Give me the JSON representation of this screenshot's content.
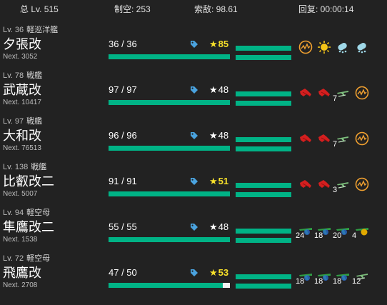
{
  "summary": {
    "total_lv": "总 Lv. 515",
    "air": "制空: 253",
    "los": "索敌: 98.61",
    "recover": "回复: 00:00:14"
  },
  "colors": {
    "background": "#222222",
    "bar_green": "#00b386",
    "sparkle_yellow": "#f7e02a",
    "tag_blue": "#4aa3df"
  },
  "ships": [
    {
      "level": "Lv. 36",
      "type": "軽巡洋艦",
      "name": "夕張改",
      "next": "Next. 3052",
      "hp": "36 / 36",
      "hp_fraction": 1.0,
      "cond": "85",
      "sparkle": true,
      "equipment": [
        {
          "icon": "radar-icon",
          "count": ""
        },
        {
          "icon": "searchlight-icon",
          "count": ""
        },
        {
          "icon": "depth-charge-icon",
          "count": ""
        },
        {
          "icon": "depth-charge-icon",
          "count": ""
        }
      ]
    },
    {
      "level": "Lv. 78",
      "type": "戦艦",
      "name": "武蔵改",
      "next": "Next. 10417",
      "hp": "97 / 97",
      "hp_fraction": 1.0,
      "cond": "48",
      "sparkle": false,
      "equipment": [
        {
          "icon": "main-gun-icon",
          "count": ""
        },
        {
          "icon": "main-gun-icon",
          "count": ""
        },
        {
          "icon": "seaplane-icon",
          "count": "7"
        },
        {
          "icon": "radar-icon",
          "count": ""
        }
      ]
    },
    {
      "level": "Lv. 97",
      "type": "戦艦",
      "name": "大和改",
      "next": "Next. 76513",
      "hp": "96 / 96",
      "hp_fraction": 1.0,
      "cond": "48",
      "sparkle": false,
      "equipment": [
        {
          "icon": "main-gun-icon",
          "count": ""
        },
        {
          "icon": "main-gun-icon",
          "count": ""
        },
        {
          "icon": "seaplane-icon",
          "count": "7"
        },
        {
          "icon": "radar-icon",
          "count": ""
        }
      ]
    },
    {
      "level": "Lv. 138",
      "type": "戦艦",
      "name": "比叡改二",
      "next": "Next. 5007",
      "hp": "91 / 91",
      "hp_fraction": 1.0,
      "cond": "51",
      "sparkle": true,
      "equipment": [
        {
          "icon": "main-gun-icon",
          "count": ""
        },
        {
          "icon": "main-gun-icon",
          "count": ""
        },
        {
          "icon": "seaplane-icon",
          "count": "3"
        },
        {
          "icon": "radar-icon",
          "count": ""
        }
      ]
    },
    {
      "level": "Lv. 94",
      "type": "軽空母",
      "name": "隼鷹改二",
      "next": "Next. 1538",
      "hp": "55 / 55",
      "hp_fraction": 1.0,
      "cond": "48",
      "sparkle": false,
      "equipment": [
        {
          "icon": "fighter-icon",
          "count": "24"
        },
        {
          "icon": "fighter-icon",
          "count": "18"
        },
        {
          "icon": "fighter-icon",
          "count": "20"
        },
        {
          "icon": "bomber-icon",
          "count": "4"
        }
      ]
    },
    {
      "level": "Lv. 72",
      "type": "軽空母",
      "name": "飛鷹改",
      "next": "Next. 2708",
      "hp": "47 / 50",
      "hp_fraction": 0.94,
      "cond": "53",
      "sparkle": true,
      "equipment": [
        {
          "icon": "fighter-icon",
          "count": "18"
        },
        {
          "icon": "fighter-icon",
          "count": "18"
        },
        {
          "icon": "fighter-icon",
          "count": "18"
        },
        {
          "icon": "seaplane-icon",
          "count": "12"
        }
      ]
    }
  ]
}
